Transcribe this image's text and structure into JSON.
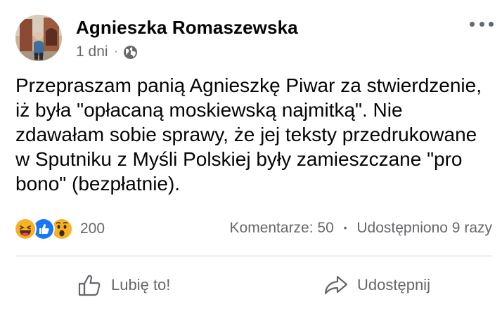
{
  "post": {
    "author": "Agnieszka Romaszewska",
    "time": "1 dni",
    "audience_icon": "globe-icon",
    "text_lines": [
      "Przepraszam panią Agnieszkę Piwar za stwierdzenie,",
      "iż była \"opłacaną moskiewską najmitką\". Nie",
      "zdawałam sobie sprawy, że jej teksty przedrukowane",
      "w Sputniku z Myśli Polskiej były zamieszczane \"pro",
      "bono\" (bezpłatnie)."
    ]
  },
  "reactions": {
    "icons": [
      "haha-icon",
      "like-icon",
      "wow-icon"
    ],
    "count": "200"
  },
  "stats": {
    "comments": "Komentarze: 50",
    "separator": "•",
    "shares": "Udostępniono 9 razy"
  },
  "actions": {
    "like_label": "Lubię to!",
    "share_label": "Udostępnij"
  },
  "colors": {
    "text": "#050505",
    "secondary": "#65676b",
    "like_blue": "#1877f2",
    "reaction_yellow": "#f7b125"
  }
}
